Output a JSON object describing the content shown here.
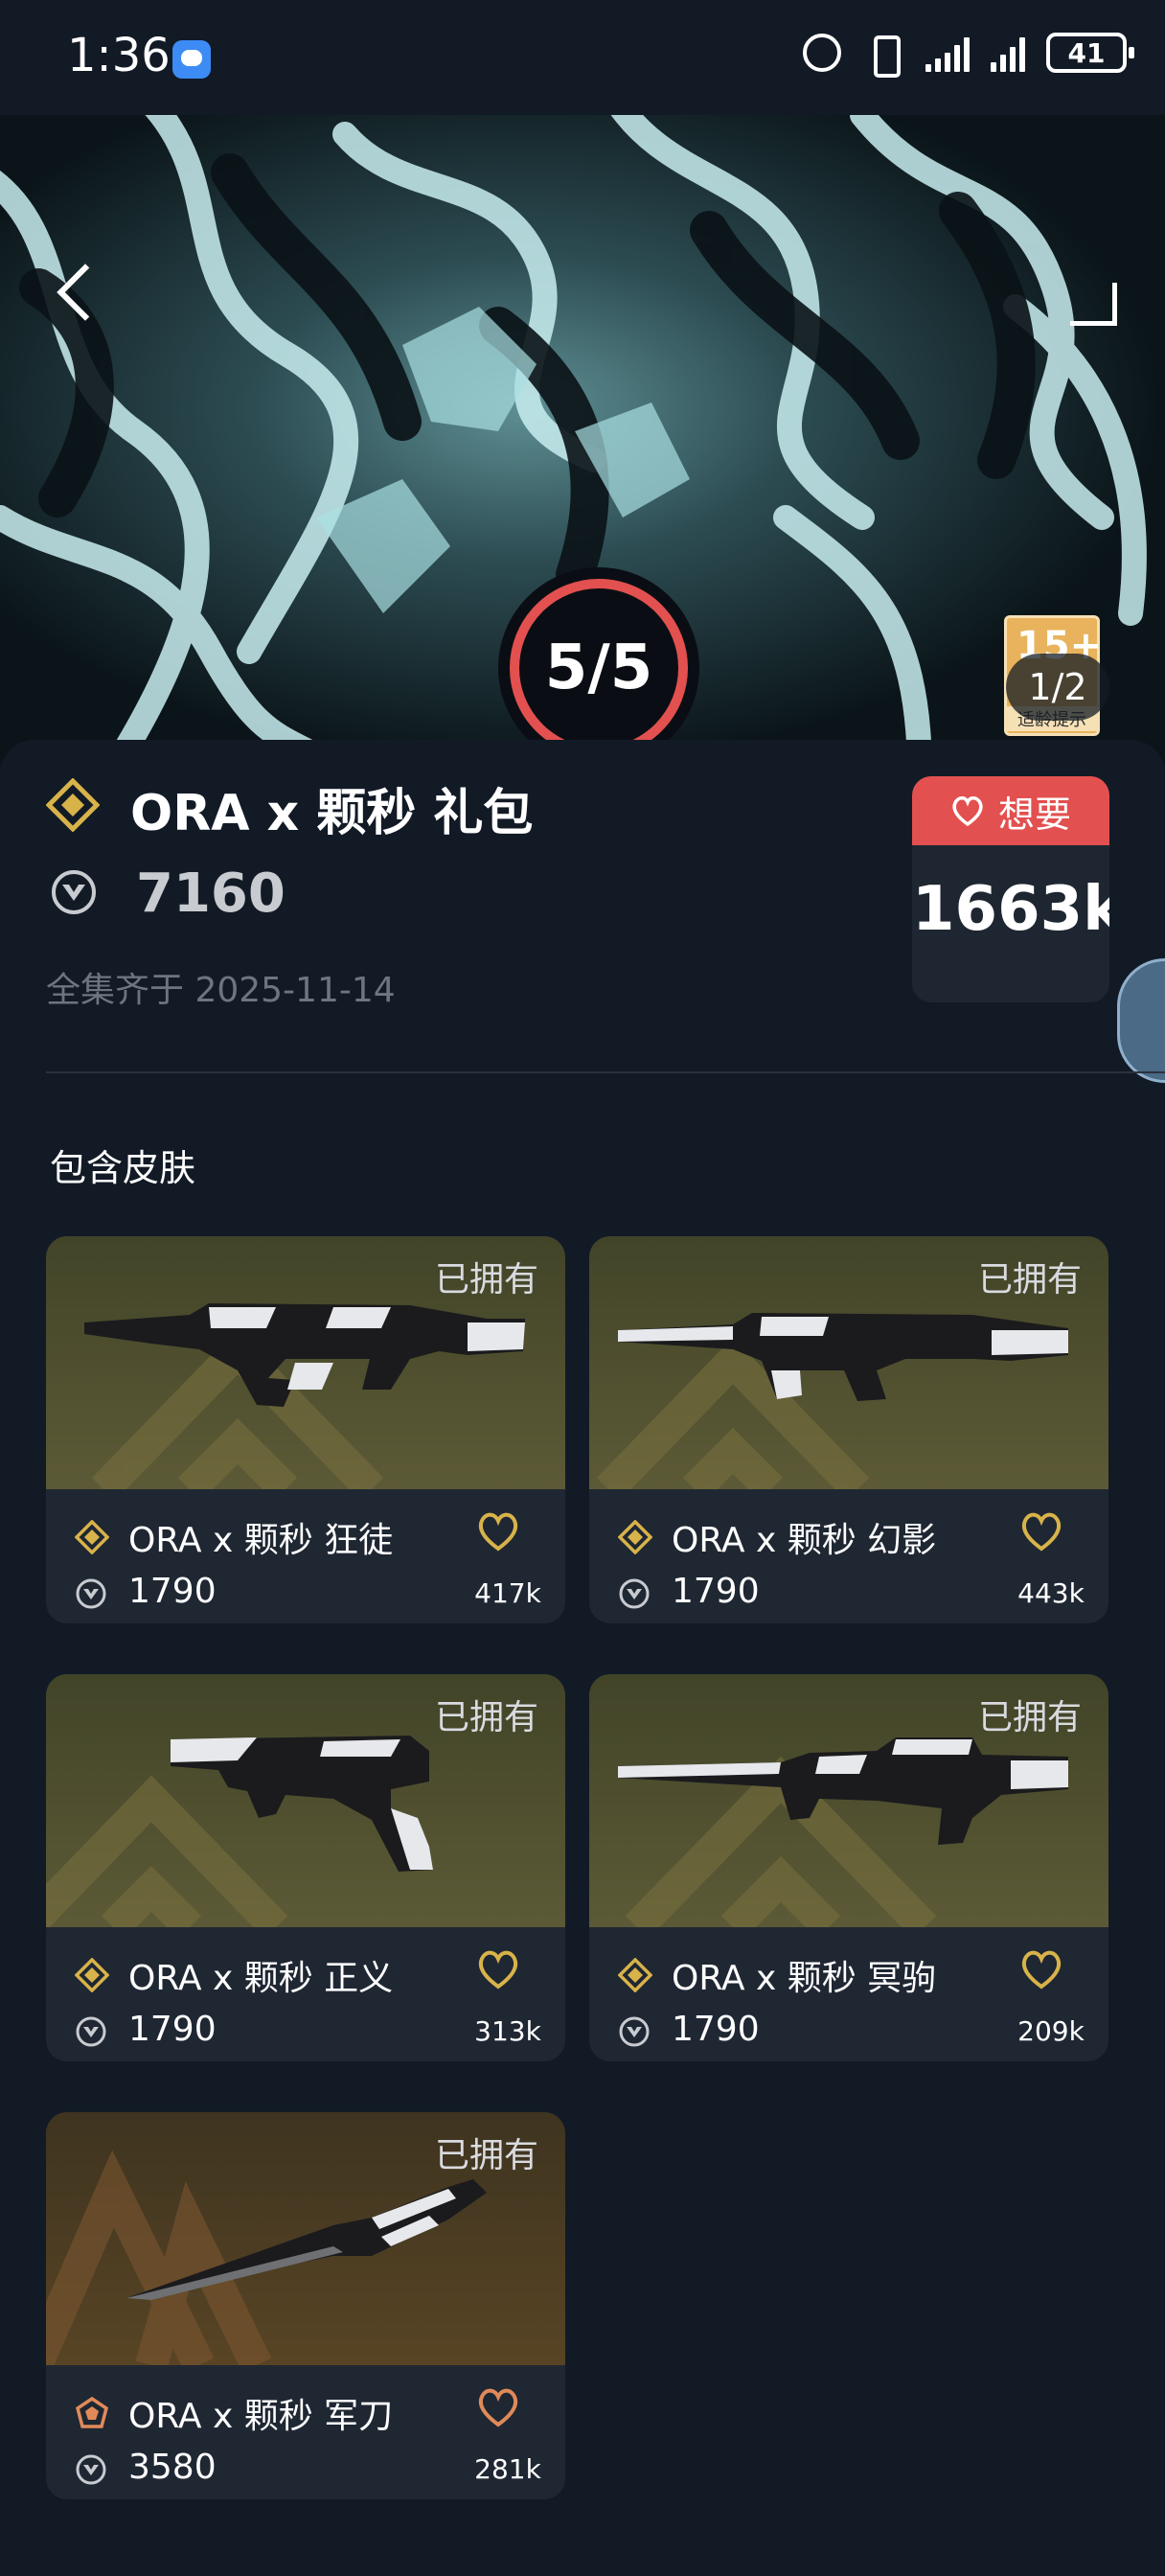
{
  "status_bar": {
    "time": "1:36",
    "battery": "41"
  },
  "hero": {
    "progress": "5/5",
    "progress_fraction": 1.0,
    "page_indicator": "1/2",
    "age_rating": "15+",
    "age_label": "适龄提示"
  },
  "bundle": {
    "title": "ORA x 颗秒 礼包",
    "price": "7160",
    "date": "全集齐于 2025-11-14",
    "wish_label": "想要",
    "wish_count": "1663k"
  },
  "section_title": "包含皮肤",
  "skins": [
    {
      "name": "ORA x 颗秒 狂徒",
      "price": "1790",
      "likes": "417k",
      "owned": "已拥有",
      "tier_color": "#d8b34a"
    },
    {
      "name": "ORA x 颗秒 幻影",
      "price": "1790",
      "likes": "443k",
      "owned": "已拥有",
      "tier_color": "#d8b34a"
    },
    {
      "name": "ORA x 颗秒 正义",
      "price": "1790",
      "likes": "313k",
      "owned": "已拥有",
      "tier_color": "#d8b34a"
    },
    {
      "name": "ORA x 颗秒 冥驹",
      "price": "1790",
      "likes": "209k",
      "owned": "已拥有",
      "tier_color": "#d8b34a"
    },
    {
      "name": "ORA x 颗秒 军刀",
      "price": "3580",
      "likes": "281k",
      "owned": "已拥有",
      "tier_color": "#e08a5a"
    }
  ],
  "colors": {
    "background": "#121a26",
    "wish_accent": "#e2504f",
    "tier_gold": "#d8b34a",
    "tier_orange": "#e08a5a"
  }
}
